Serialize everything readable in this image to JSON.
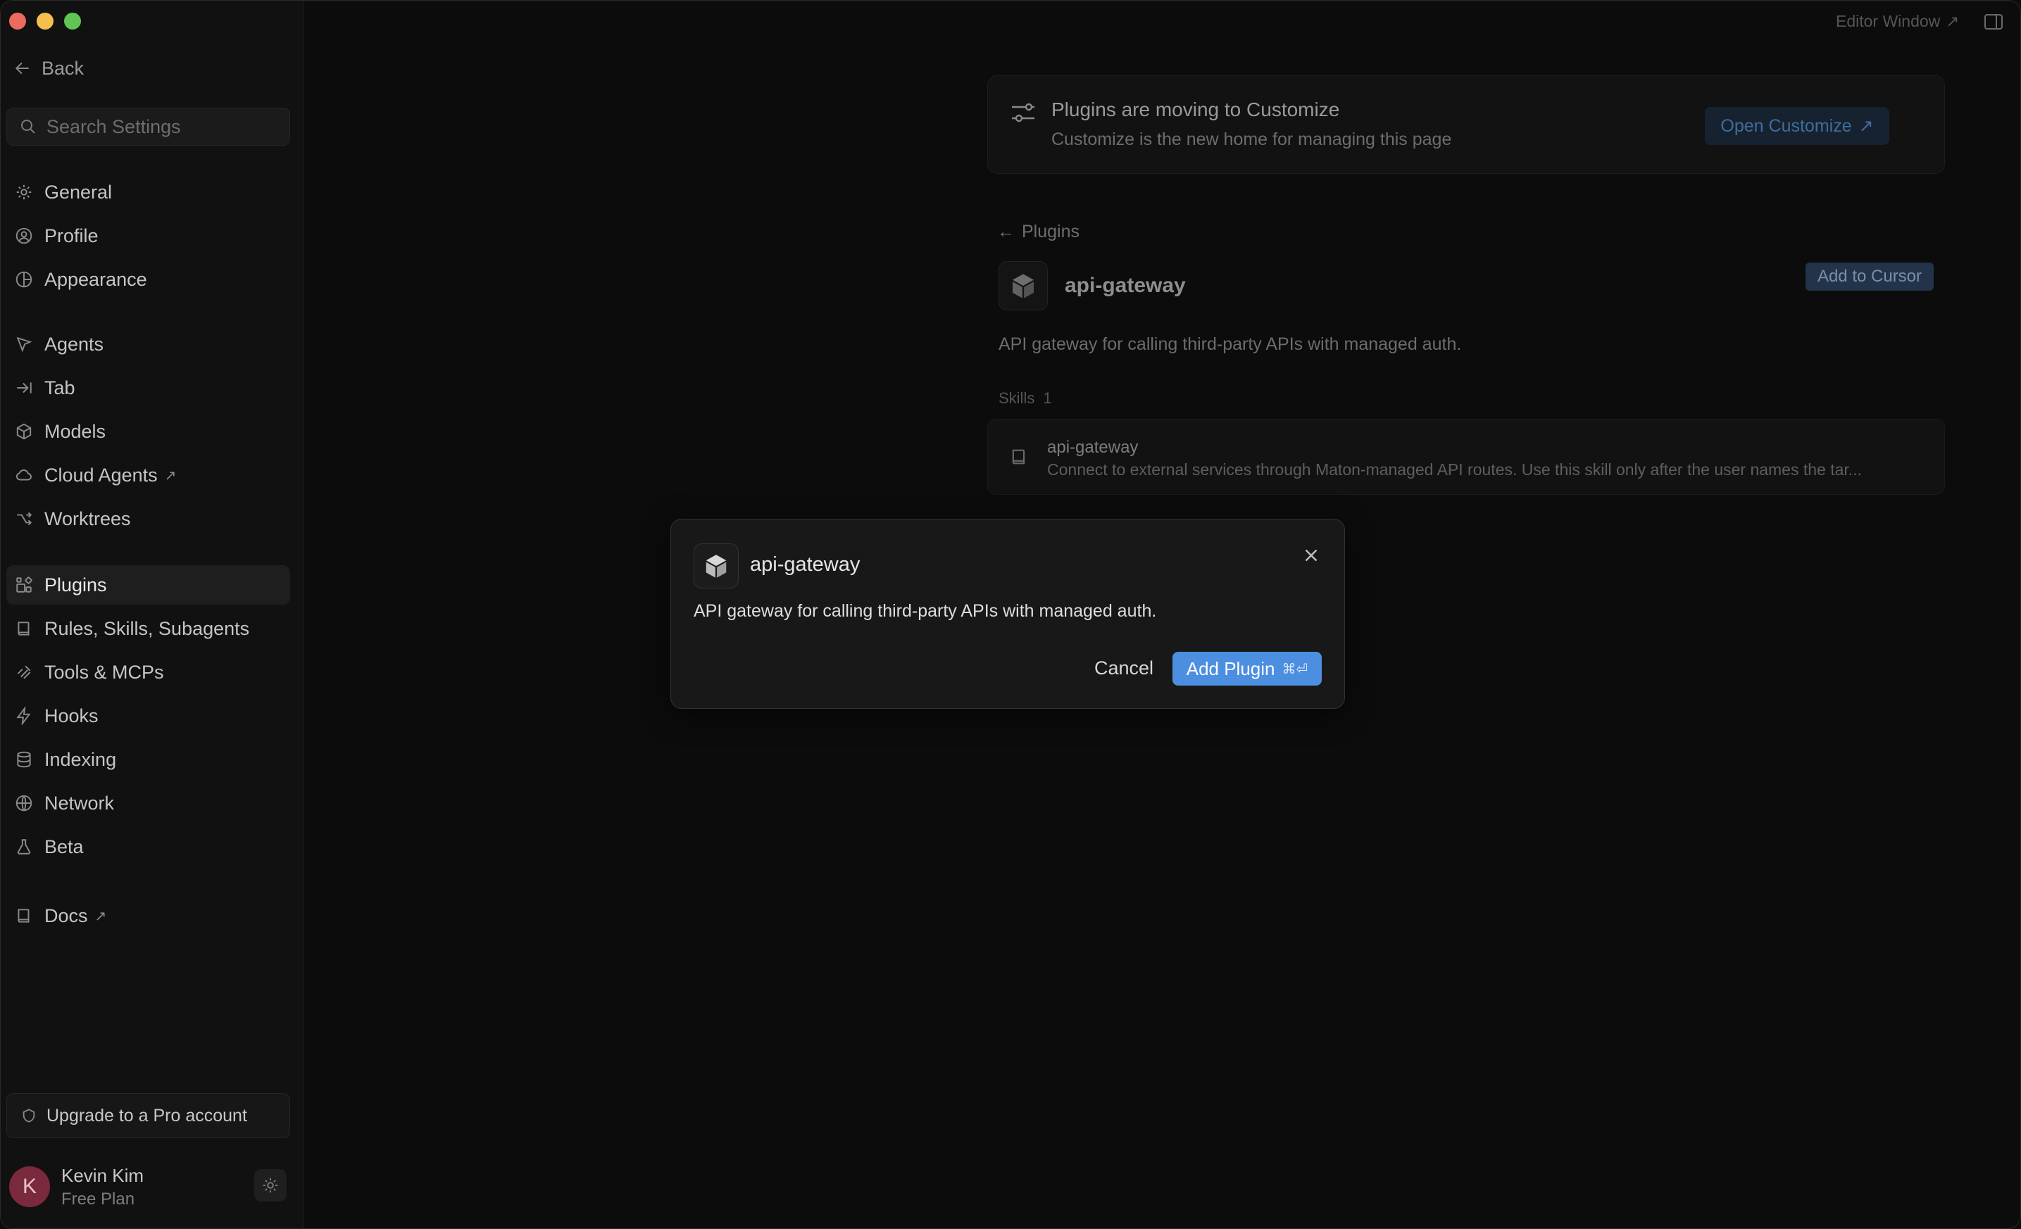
{
  "sidebar": {
    "back_label": "Back",
    "search_placeholder": "Search Settings",
    "groups": {
      "general": "General",
      "profile": "Profile",
      "appearance": "Appearance",
      "agents": "Agents",
      "tab": "Tab",
      "models": "Models",
      "cloud_agents": "Cloud Agents",
      "worktrees": "Worktrees",
      "plugins": "Plugins",
      "rules": "Rules, Skills, Subagents",
      "tools": "Tools & MCPs",
      "hooks": "Hooks",
      "indexing": "Indexing",
      "network": "Network",
      "beta": "Beta",
      "docs": "Docs"
    },
    "external_glyph": "↗",
    "upgrade_label": "Upgrade to a Pro account",
    "user": {
      "initial": "K",
      "name": "Kevin Kim",
      "plan": "Free Plan"
    }
  },
  "topbar": {
    "editor_window": "Editor Window",
    "external_glyph": "↗"
  },
  "banner": {
    "title": "Plugins are moving to Customize",
    "subtitle": "Customize is the new home for managing this page",
    "button": "Open Customize",
    "button_glyph": "↗"
  },
  "plugin_page": {
    "breadcrumb": "Plugins",
    "breadcrumb_arrow": "←",
    "name": "api-gateway",
    "add_button": "Add to Cursor",
    "description": "API gateway for calling third-party APIs with managed auth.",
    "skills_label": "Skills",
    "skills_count": "1",
    "skill": {
      "title": "api-gateway",
      "description": "Connect to external services through Maton-managed API routes. Use this skill only after the user names the tar..."
    }
  },
  "modal": {
    "title": "api-gateway",
    "description": "API gateway for calling third-party APIs with managed auth.",
    "cancel": "Cancel",
    "add": "Add Plugin",
    "shortcut": "⌘⏎"
  },
  "colors": {
    "accent": "#4c8ee0",
    "avatar": "#7a2a3c"
  }
}
